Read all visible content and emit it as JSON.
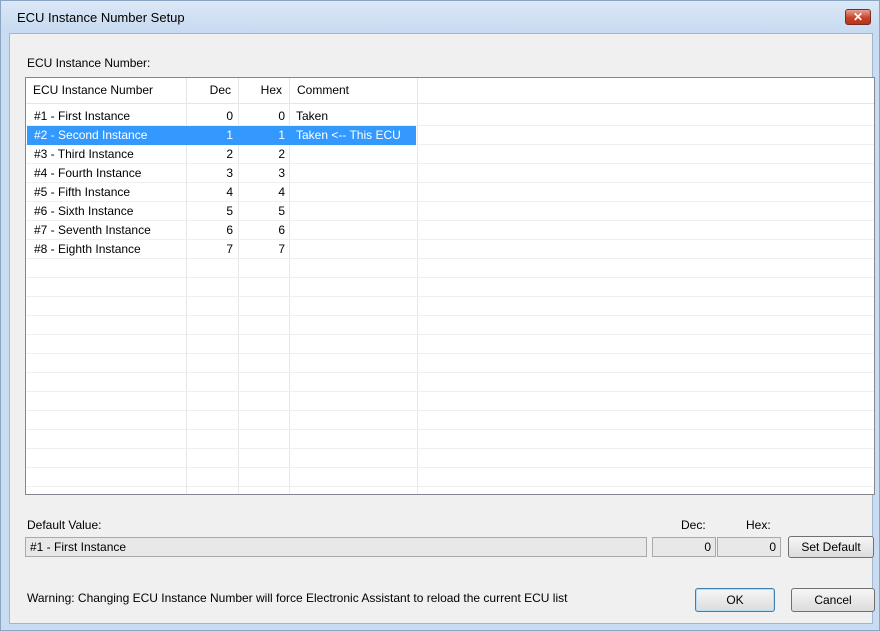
{
  "window": {
    "title": "ECU Instance Number Setup",
    "close_glyph": "✕"
  },
  "section_label": "ECU Instance Number:",
  "table": {
    "columns": [
      "ECU Instance Number",
      "Dec",
      "Hex",
      "Comment"
    ],
    "rows": [
      {
        "name": "#1 - First Instance",
        "dec": "0",
        "hex": "0",
        "comment": "Taken"
      },
      {
        "name": "#2 - Second Instance",
        "dec": "1",
        "hex": "1",
        "comment": "Taken <-- This ECU"
      },
      {
        "name": "#3 - Third Instance",
        "dec": "2",
        "hex": "2",
        "comment": ""
      },
      {
        "name": "#4 - Fourth Instance",
        "dec": "3",
        "hex": "3",
        "comment": ""
      },
      {
        "name": "#5 - Fifth Instance",
        "dec": "4",
        "hex": "4",
        "comment": ""
      },
      {
        "name": "#6 - Sixth Instance",
        "dec": "5",
        "hex": "5",
        "comment": ""
      },
      {
        "name": "#7 - Seventh Instance",
        "dec": "6",
        "hex": "6",
        "comment": ""
      },
      {
        "name": "#8 - Eighth Instance",
        "dec": "7",
        "hex": "7",
        "comment": ""
      }
    ],
    "selected_row": 1
  },
  "default": {
    "label": "Default Value:",
    "value": "#1 - First Instance",
    "dec_label": "Dec:",
    "hex_label": "Hex:",
    "dec_value": "0",
    "hex_value": "0",
    "set_default_label": "Set Default"
  },
  "warning": "Warning: Changing ECU Instance Number will force Electronic Assistant to reload the current ECU list",
  "buttons": {
    "ok": "OK",
    "cancel": "Cancel"
  },
  "colors": {
    "selection": "#3399ff",
    "close": "#c7432b"
  }
}
